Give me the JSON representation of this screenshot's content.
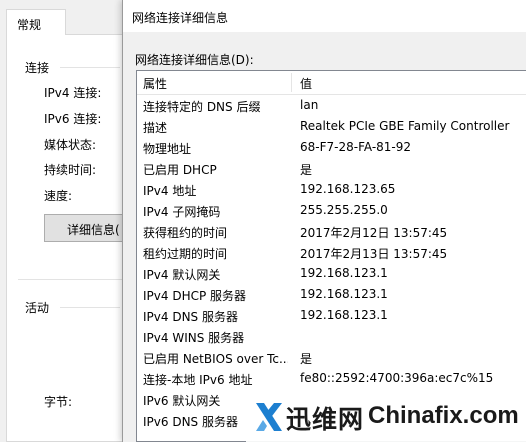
{
  "background_window": {
    "tab_label": "常规",
    "connection_group": "连接",
    "ipv4_connectivity": "IPv4 连接:",
    "ipv6_connectivity": "IPv6 连接:",
    "media_state": "媒体状态:",
    "duration": "持续时间:",
    "speed": "速度:",
    "details_button": "详细信息(",
    "activity_group": "活动",
    "bytes": "字节:"
  },
  "dialog": {
    "title": "网络连接详细信息",
    "list_label": "网络连接详细信息(D):",
    "columns": {
      "property": "属性",
      "value": "值"
    },
    "rows": [
      {
        "property": "连接特定的 DNS 后缀",
        "value": "lan"
      },
      {
        "property": "描述",
        "value": "Realtek PCIe GBE Family Controller"
      },
      {
        "property": "物理地址",
        "value": "68-F7-28-FA-81-92"
      },
      {
        "property": "已启用 DHCP",
        "value": "是"
      },
      {
        "property": "IPv4 地址",
        "value": "192.168.123.65"
      },
      {
        "property": "IPv4 子网掩码",
        "value": "255.255.255.0"
      },
      {
        "property": "获得租约的时间",
        "value": "2017年2月12日 13:57:45"
      },
      {
        "property": "租约过期的时间",
        "value": "2017年2月13日 13:57:45"
      },
      {
        "property": "IPv4 默认网关",
        "value": "192.168.123.1"
      },
      {
        "property": "IPv4 DHCP 服务器",
        "value": "192.168.123.1"
      },
      {
        "property": "IPv4 DNS 服务器",
        "value": "192.168.123.1"
      },
      {
        "property": "IPv4 WINS 服务器",
        "value": ""
      },
      {
        "property": "已启用 NetBIOS over Tc...",
        "value": "是"
      },
      {
        "property": "连接-本地 IPv6 地址",
        "value": "fe80::2592:4700:396a:ec7c%15"
      },
      {
        "property": "IPv6 默认网关",
        "value": ""
      },
      {
        "property": "IPv6 DNS 服务器",
        "value": ""
      }
    ]
  },
  "watermark": {
    "brand_cn": "迅维网",
    "brand_en": "Chinafix.com",
    "logo_color": "#1d7fd0",
    "icon": "x-logo-icon"
  }
}
